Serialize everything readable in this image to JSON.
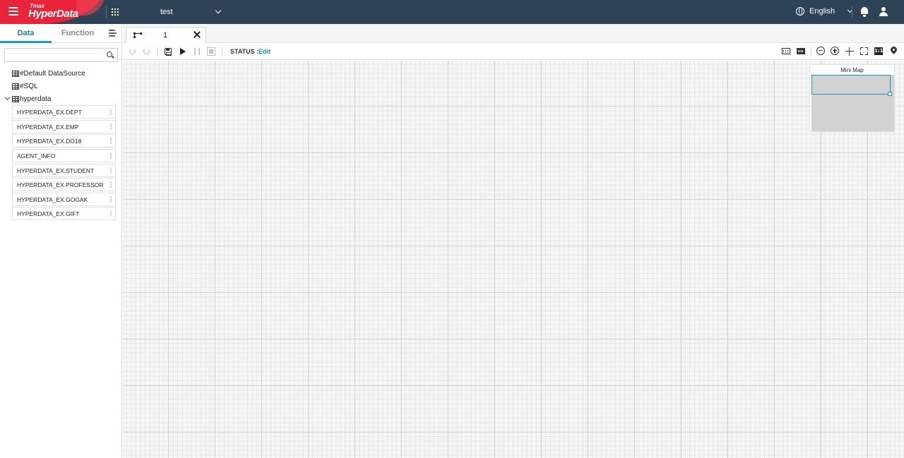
{
  "header": {
    "brand_small": "Tmax",
    "brand_name": "HyperData",
    "workspace": "test",
    "language": "English"
  },
  "left_panel": {
    "tabs": [
      "Data",
      "Function"
    ],
    "search_placeholder": "",
    "tree": [
      {
        "label": "#Default DataSource"
      },
      {
        "label": "#SQL"
      },
      {
        "label": "hyperdata"
      }
    ],
    "datasets": [
      "HYPERDATA_EX.DEPT",
      "HYPERDATA_EX.EMP",
      "HYPERDATA_EX.DO18",
      "AGENT_INFO",
      "HYPERDATA_EX.STUDENT",
      "HYPERDATA_EX.PROFESSOR",
      "HYPERDATA_EX.GOGAK",
      "HYPERDATA_EX.GIFT"
    ]
  },
  "tabs": [
    {
      "label": "1",
      "icon": "flow-icon"
    }
  ],
  "toolbar": {
    "status_label": "STATUS :",
    "status_value": "Edit",
    "ratio_label": "1:1",
    "icons": [
      "undo-icon",
      "redo-icon",
      "save-icon",
      "play-icon",
      "pause-icon",
      "stop-icon",
      "keyboard-icon",
      "keyboard-alt-icon",
      "zoom-out-icon",
      "zoom-in-icon",
      "move-icon",
      "fit-screen-icon",
      "ratio-icon",
      "pin-icon"
    ]
  },
  "minimap": {
    "title": "Mini Map"
  },
  "colors": {
    "topbar": "#2f4356",
    "brand_red": "#e8233a",
    "accent": "#1a9fc7",
    "status_value": "#1a8ec0"
  }
}
